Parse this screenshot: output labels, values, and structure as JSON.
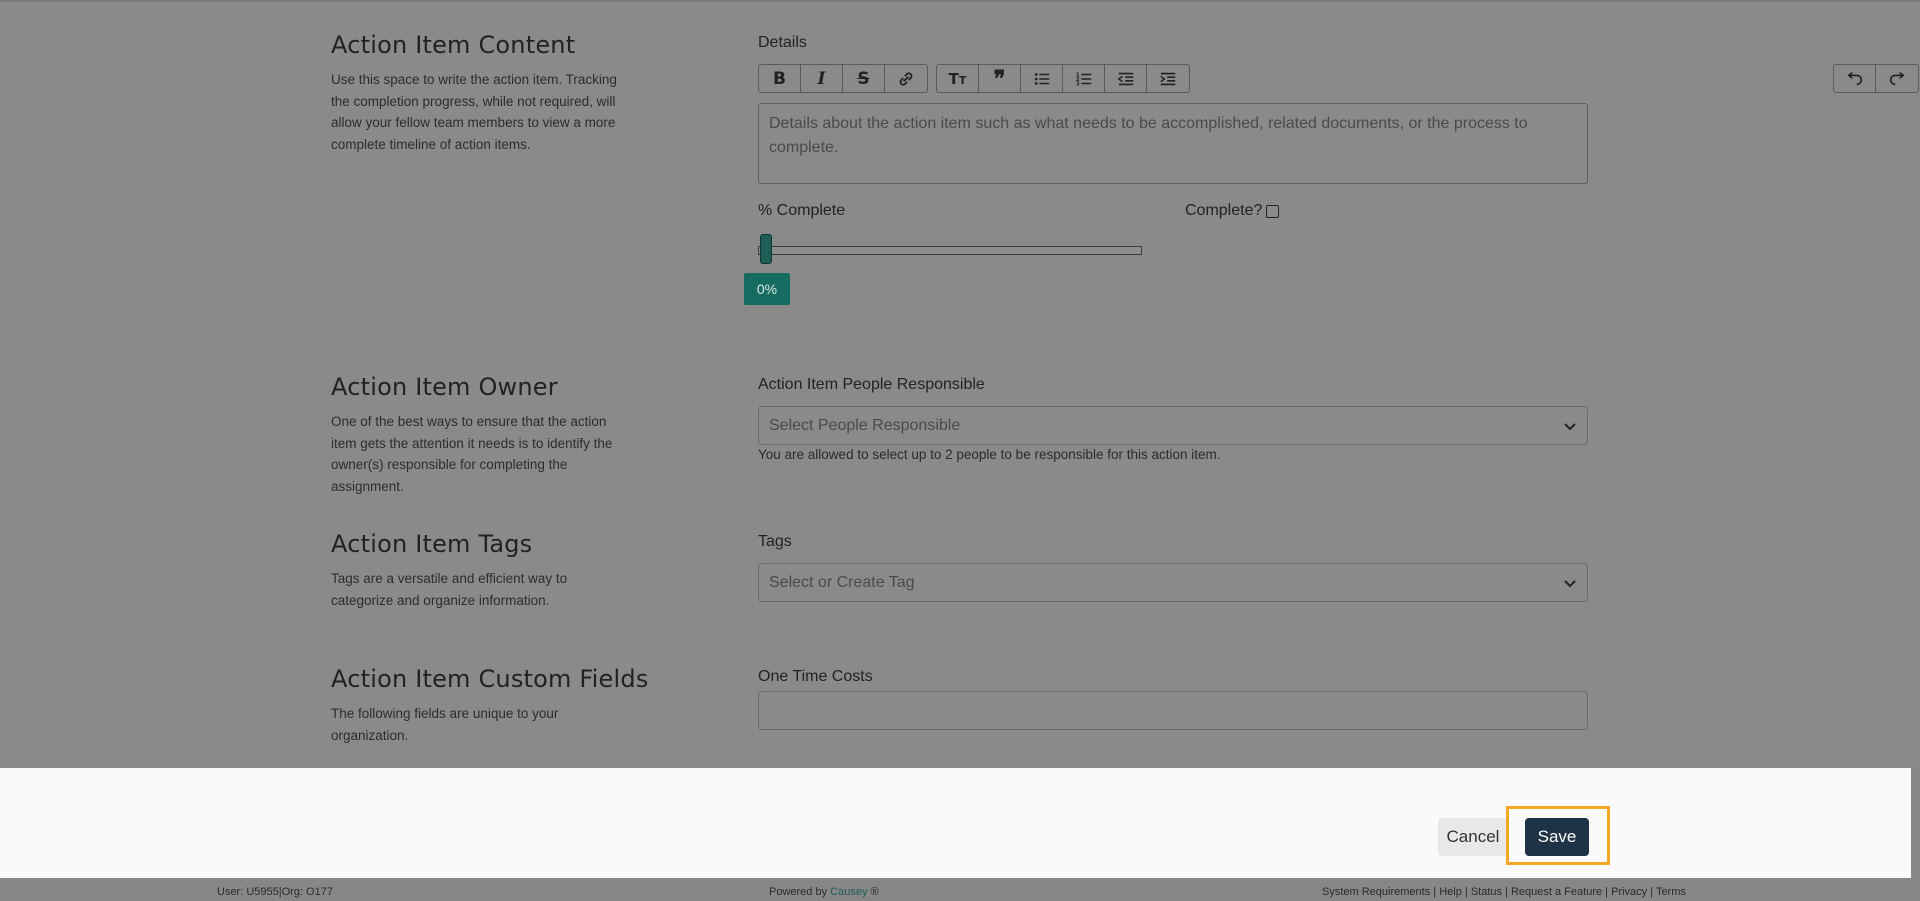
{
  "content_section": {
    "title": "Action Item Content",
    "description": "Use this space to write the action item. Tracking the completion progress, while not required, will allow your fellow team members to view a more complete timeline of action items.",
    "details_label": "Details",
    "editor_placeholder": "Details about the action item such as what needs to be accomplished, related documents, or the process to complete.",
    "percent_label": "% Complete",
    "percent_value": "0%",
    "percent_fraction": 0,
    "complete_label": "Complete?",
    "complete_checked": false
  },
  "toolbar": {
    "format_icons": [
      "bold-icon",
      "italic-icon",
      "strikethrough-icon",
      "link-icon"
    ],
    "block_icons": [
      "heading-icon",
      "quote-icon",
      "bullet-list-icon",
      "numbered-list-icon",
      "outdent-icon",
      "indent-icon"
    ],
    "history_icons": [
      "undo-icon",
      "redo-icon"
    ]
  },
  "owner_section": {
    "title": "Action Item Owner",
    "description": "One of the best ways to ensure that the action item gets the attention it needs is to identify the owner(s) responsible for completing the assignment.",
    "field_label": "Action Item People Responsible",
    "select_placeholder": "Select People Responsible",
    "help_text": "You are allowed to select up to 2 people to be responsible for this action item."
  },
  "tags_section": {
    "title": "Action Item Tags",
    "description": "Tags are a versatile and efficient way to categorize and organize information.",
    "field_label": "Tags",
    "select_placeholder": "Select or Create Tag"
  },
  "custom_section": {
    "title": "Action Item Custom Fields",
    "description": "The following fields are unique to your organization.",
    "field_label": "One Time Costs",
    "field_value": ""
  },
  "actions": {
    "cancel_label": "Cancel",
    "save_label": "Save",
    "highlight_color": "#f5a623",
    "save_color": "#1f3346"
  },
  "footer": {
    "user_info": "User: U5955|Org: O177",
    "powered_prefix": "Powered by ",
    "powered_brand": "Causey",
    "powered_suffix": " ®",
    "links": [
      "System Requirements",
      "Help",
      "Status",
      "Request a Feature",
      "Privacy",
      "Terms"
    ]
  }
}
